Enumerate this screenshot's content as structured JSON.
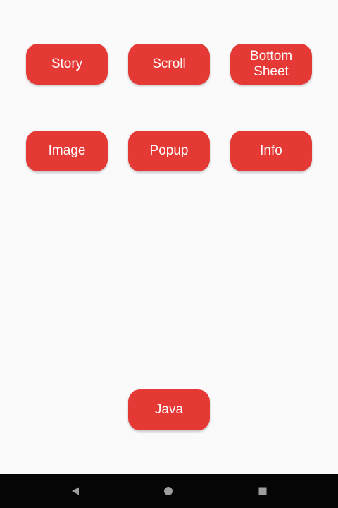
{
  "buttons": {
    "story": "Story",
    "scroll": "Scroll",
    "bottom_sheet": "Bottom\nSheet",
    "image": "Image",
    "popup": "Popup",
    "info": "Info",
    "java": "Java"
  },
  "nav_bar": {
    "icons": [
      "back-triangle-icon",
      "home-circle-icon",
      "recents-square-icon"
    ]
  },
  "colors": {
    "button_bg": "#e53935",
    "screen_bg": "#fafafa",
    "nav_bg": "#050505",
    "nav_icon": "#9e9e9e"
  }
}
